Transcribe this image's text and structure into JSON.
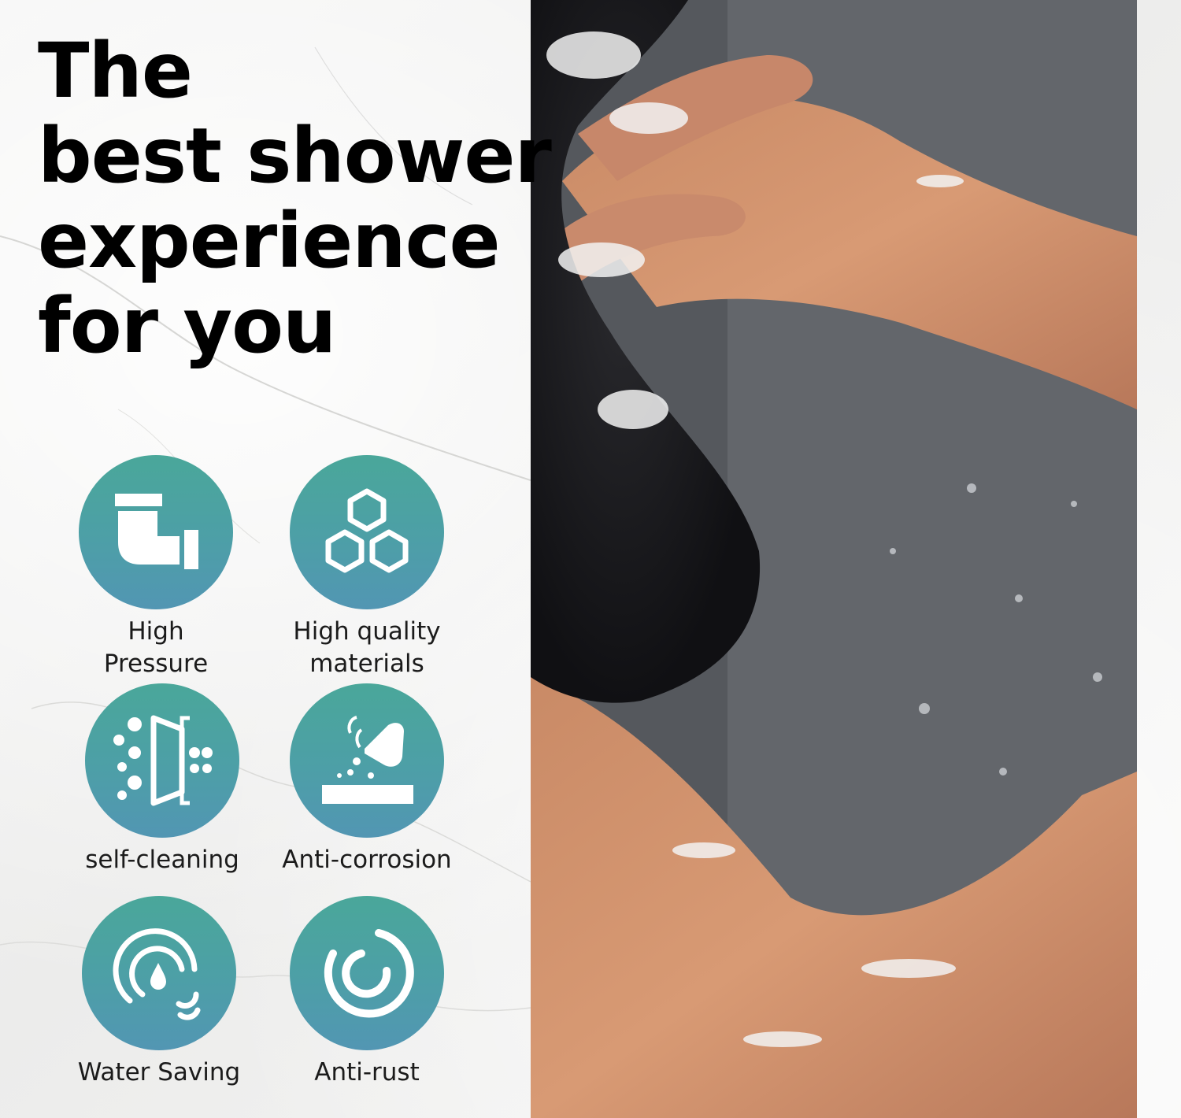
{
  "headline": {
    "line1": "The",
    "line2": "best shower",
    "line3": "experience",
    "line4": "for you"
  },
  "features": [
    {
      "label": "High\nPressure",
      "icon": "pipe-elbow-icon"
    },
    {
      "label": "High quality\nmaterials",
      "icon": "hexagon-cluster-icon"
    },
    {
      "label": "self-cleaning",
      "icon": "filter-particles-icon"
    },
    {
      "label": "Anti-corrosion",
      "icon": "acid-pour-icon"
    },
    {
      "label": "Water Saving",
      "icon": "water-drop-recycle-icon"
    },
    {
      "label": "Anti-rust",
      "icon": "ring-icon"
    }
  ],
  "colors": {
    "icon_gradient_top": "#4aa79a",
    "icon_gradient_bottom": "#5296b3",
    "headline": "#000000"
  }
}
